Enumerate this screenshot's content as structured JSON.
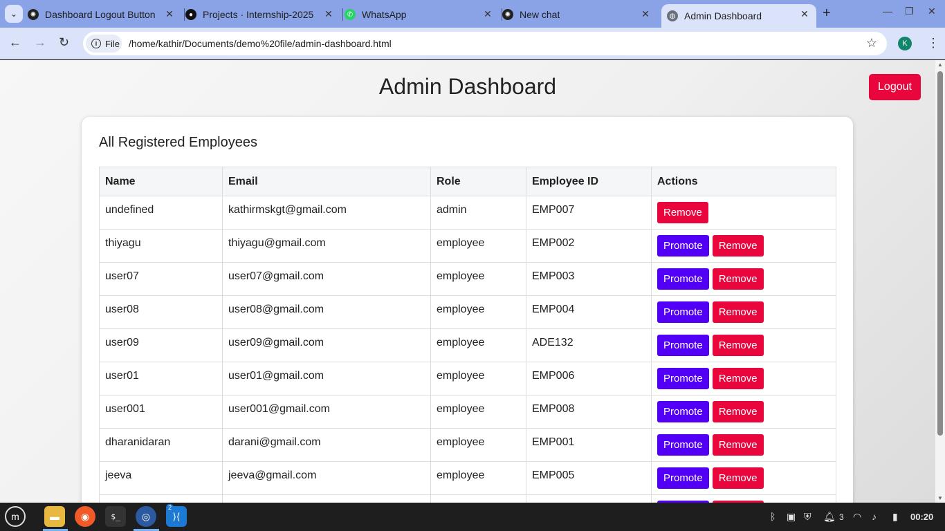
{
  "browser": {
    "tabs": [
      {
        "label": "Dashboard Logout Button",
        "icon": "chatgpt-icon"
      },
      {
        "label": "Projects · Internship-2025",
        "icon": "github-icon"
      },
      {
        "label": "WhatsApp",
        "icon": "whatsapp-icon"
      },
      {
        "label": "New chat",
        "icon": "chatgpt-icon"
      },
      {
        "label": "Admin Dashboard",
        "icon": "globe-icon",
        "active": true
      }
    ],
    "address_chip": "File",
    "url": "/home/kathir/Documents/demo%20file/admin-dashboard.html",
    "profile_initial": "K"
  },
  "page": {
    "title": "Admin Dashboard",
    "logout_label": "Logout",
    "section_title": "All Registered Employees",
    "columns": [
      "Name",
      "Email",
      "Role",
      "Employee ID",
      "Actions"
    ],
    "promote_label": "Promote",
    "remove_label": "Remove",
    "rows": [
      {
        "name": "undefined",
        "email": "kathirmskgt@gmail.com",
        "role": "admin",
        "id": "EMP007",
        "promote": false
      },
      {
        "name": "thiyagu",
        "email": "thiyagu@gmail.com",
        "role": "employee",
        "id": "EMP002",
        "promote": true
      },
      {
        "name": "user07",
        "email": "user07@gmail.com",
        "role": "employee",
        "id": "EMP003",
        "promote": true
      },
      {
        "name": "user08",
        "email": "user08@gmail.com",
        "role": "employee",
        "id": "EMP004",
        "promote": true
      },
      {
        "name": "user09",
        "email": "user09@gmail.com",
        "role": "employee",
        "id": "ADE132",
        "promote": true
      },
      {
        "name": "user01",
        "email": "user01@gmail.com",
        "role": "employee",
        "id": "EMP006",
        "promote": true
      },
      {
        "name": "user001",
        "email": "user001@gmail.com",
        "role": "employee",
        "id": "EMP008",
        "promote": true
      },
      {
        "name": "dharanidaran",
        "email": "darani@gmail.com",
        "role": "employee",
        "id": "EMP001",
        "promote": true
      },
      {
        "name": "jeeva",
        "email": "jeeva@gmail.com",
        "role": "employee",
        "id": "EMP005",
        "promote": true
      }
    ]
  },
  "colors": {
    "logout": "#e8063c",
    "promote": "#5200f5",
    "remove": "#e8063c"
  },
  "taskbar": {
    "apps": [
      "mint-menu-icon",
      "files-icon",
      "firefox-icon",
      "terminal-icon",
      "chrome-icon",
      "vscode-icon"
    ],
    "vscode_badge": "2",
    "notification_count": "3",
    "clock": "00:20"
  }
}
